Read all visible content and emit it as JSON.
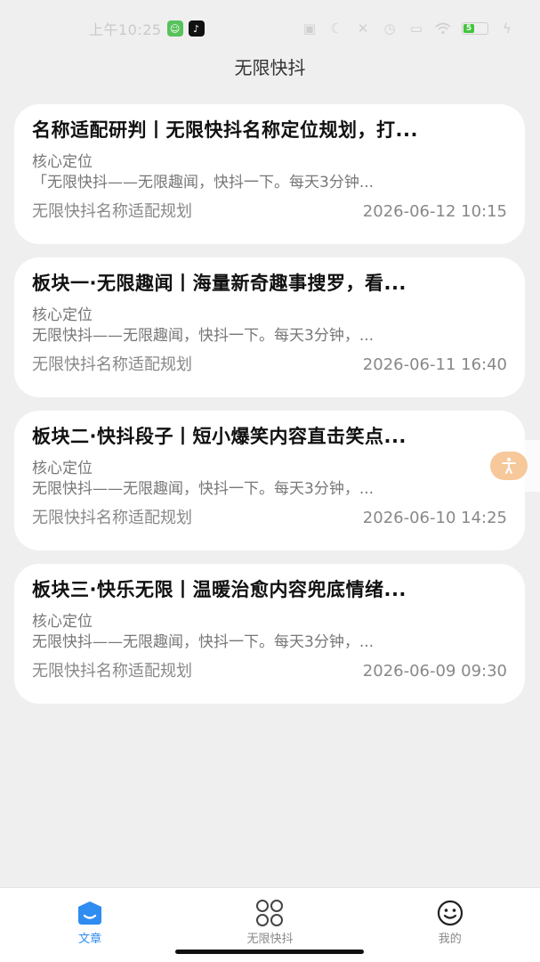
{
  "status_bar": {
    "time": "上午10:25",
    "battery_level": "5",
    "battery_percent": 20
  },
  "header": {
    "title": "无限快抖"
  },
  "articles": [
    {
      "title": "名称适配研判丨无限快抖名称定位规划，打...",
      "label": "核心定位",
      "summary": "「无限快抖——无限趣闻，快抖一下。每天3分钟...",
      "source": "无限快抖名称适配规划",
      "date": "2026-06-12 10:15"
    },
    {
      "title": "板块一·无限趣闻丨海量新奇趣事搜罗，看...",
      "label": "核心定位",
      "summary": "无限快抖——无限趣闻，快抖一下。每天3分钟，...",
      "source": "无限快抖名称适配规划",
      "date": "2026-06-11 16:40"
    },
    {
      "title": "板块二·快抖段子丨短小爆笑内容直击笑点...",
      "label": "核心定位",
      "summary": "无限快抖——无限趣闻，快抖一下。每天3分钟，...",
      "source": "无限快抖名称适配规划",
      "date": "2026-06-10 14:25"
    },
    {
      "title": "板块三·快乐无限丨温暖治愈内容兜底情绪...",
      "label": "核心定位",
      "summary": "无限快抖——无限趣闻，快抖一下。每天3分钟，...",
      "source": "无限快抖名称适配规划",
      "date": "2026-06-09 09:30"
    }
  ],
  "bottom_nav": {
    "items": [
      {
        "label": "文章",
        "icon": "article-icon",
        "active": true
      },
      {
        "label": "无限快抖",
        "icon": "grid-icon",
        "active": false
      },
      {
        "label": "我的",
        "icon": "smiley-icon",
        "active": false
      }
    ]
  },
  "colors": {
    "accent": "#2f8cf0",
    "background": "#efefef",
    "card": "#ffffff",
    "float_button": "#f6c89a"
  }
}
